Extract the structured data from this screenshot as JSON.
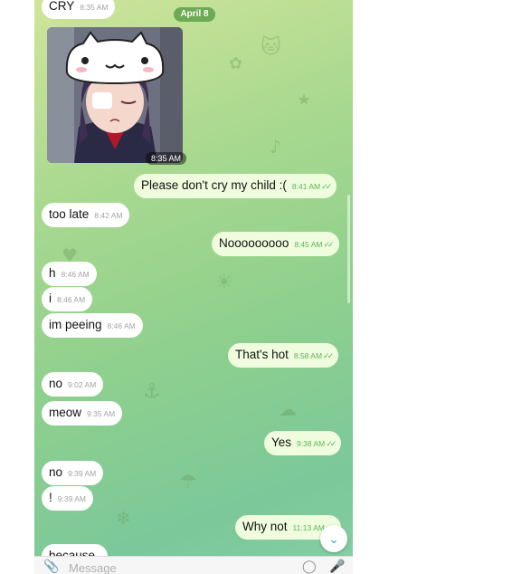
{
  "date_pill": "April 8",
  "photo": {
    "time": "8:35 AM"
  },
  "messages": [
    {
      "dir": "in",
      "text": "CRY",
      "time": "8:35 AM"
    },
    {
      "dir": "out",
      "text": "Please don't cry my child :(",
      "time": "8:41 AM",
      "read": true
    },
    {
      "dir": "in",
      "text": "too late",
      "time": "8:42 AM"
    },
    {
      "dir": "out",
      "text": "Nooooooooo",
      "time": "8:45 AM",
      "read": true
    },
    {
      "dir": "in",
      "text": "h",
      "time": "8:46 AM"
    },
    {
      "dir": "in",
      "text": "i",
      "time": "8:46 AM"
    },
    {
      "dir": "in",
      "text": "im peeing",
      "time": "8:46 AM"
    },
    {
      "dir": "out",
      "text": "That's hot",
      "time": "8:58 AM",
      "read": true
    },
    {
      "dir": "in",
      "text": "no",
      "time": "9:02 AM"
    },
    {
      "dir": "in",
      "text": "meow",
      "time": "9:35 AM"
    },
    {
      "dir": "out",
      "text": "Yes",
      "time": "9:38 AM",
      "read": true
    },
    {
      "dir": "in",
      "text": "no",
      "time": "9:39 AM"
    },
    {
      "dir": "in",
      "text": "!",
      "time": "9:39 AM"
    },
    {
      "dir": "out",
      "text": "Why not",
      "time": "11:13 AM",
      "read": true
    },
    {
      "dir": "in",
      "text": "because",
      "time": ""
    }
  ],
  "read_mark": "✓✓",
  "icons": {
    "attach": "paperclip-icon",
    "sticker": "sticker-icon",
    "mic": "microphone-icon",
    "scroll_down": "chevron-down-icon"
  },
  "input": {
    "placeholder": "Message"
  },
  "colors": {
    "outgoing_bubble": "#effdde",
    "incoming_bubble": "#ffffff",
    "read_tick": "#5fb25a",
    "date_pill": "#5da048"
  }
}
